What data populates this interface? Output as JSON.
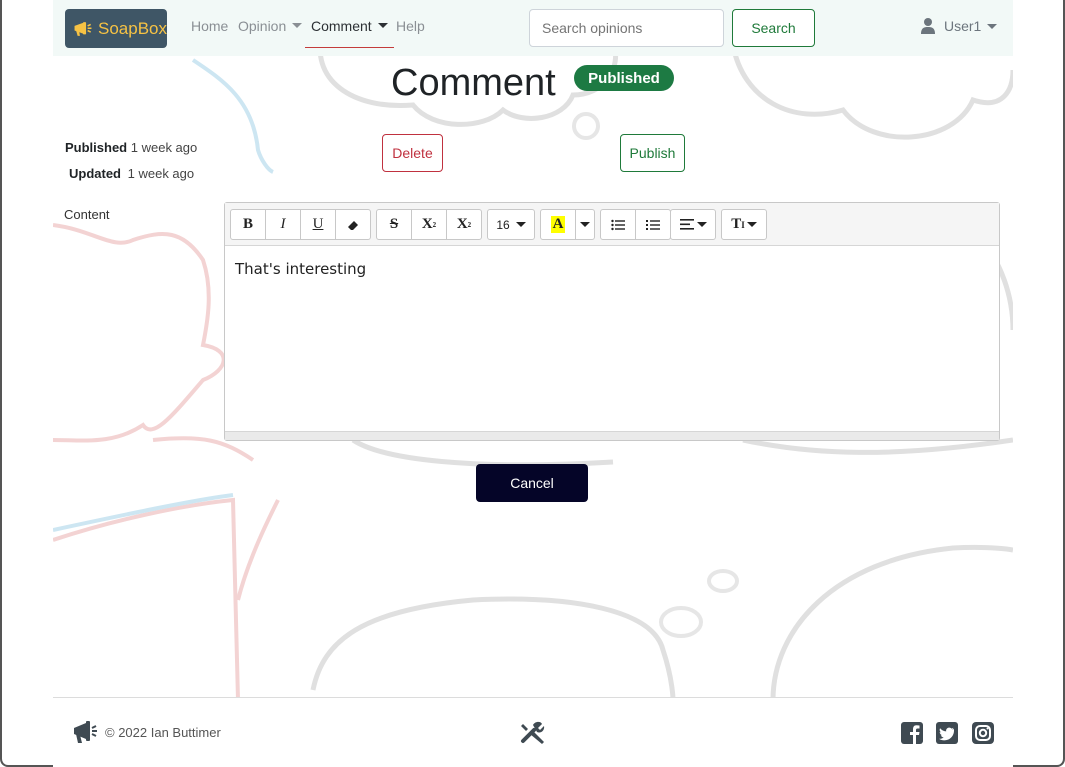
{
  "navbar": {
    "brand": "SoapBox",
    "links": [
      {
        "label": "Home"
      },
      {
        "label": "Opinion"
      },
      {
        "label": "Comment"
      },
      {
        "label": "Help"
      }
    ],
    "search_placeholder": "Search opinions",
    "search_button": "Search",
    "user": "User1"
  },
  "page": {
    "title": "Comment",
    "status": "Published",
    "published_label": "Published",
    "published_value": "1 week ago",
    "updated_label": "Updated",
    "updated_value": "1 week ago",
    "delete_button": "Delete",
    "publish_button": "Publish",
    "content_label": "Content",
    "content_text": "That's interesting",
    "cancel_button": "Cancel"
  },
  "toolbar": {
    "bold": "B",
    "italic": "I",
    "underline": "U",
    "strikethrough": "S",
    "superscript": "X",
    "subscript": "X",
    "font_size": "16",
    "highlight": "A",
    "paragraph_style": "T"
  },
  "footer": {
    "copyright": "© 2022 Ian Buttimer"
  },
  "colors": {
    "brand_bg": "#3f5666",
    "brand_text": "#f6c244",
    "published_badge": "#1d7a43",
    "delete": "#c0313f",
    "publish": "#1f7a3a",
    "cancel_bg": "#050528"
  }
}
